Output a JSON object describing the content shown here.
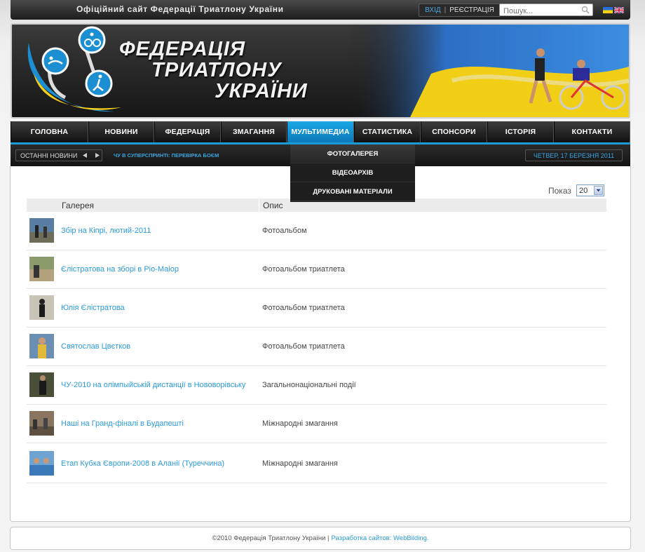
{
  "topbar": {
    "site_title": "Офіційний сайт Федерації Триатлону України",
    "login": "ВХІД",
    "separator": "|",
    "register": "РЕЄСТРАЦІЯ",
    "search_placeholder": "Пошук..."
  },
  "banner": {
    "title_line1": "ФЕДЕРАЦІЯ",
    "title_line2": "ТРИАТЛОНУ",
    "title_line3": "УКРАЇНИ"
  },
  "nav": {
    "items": [
      {
        "label": "ГОЛОВНА"
      },
      {
        "label": "НОВИНИ"
      },
      {
        "label": "ФЕДЕРАЦІЯ"
      },
      {
        "label": "ЗМАГАННЯ"
      },
      {
        "label": "МУЛЬТИМЕДИА"
      },
      {
        "label": "СТАТИСТИКА"
      },
      {
        "label": "СПОНСОРИ"
      },
      {
        "label": "ІСТОРІЯ"
      },
      {
        "label": "КОНТАКТИ"
      }
    ],
    "active_index": 4
  },
  "dropdown": {
    "items": [
      "ФОТОГАЛЕРЕЯ",
      "ВІДЕОАРХІВ",
      "ДРУКОВАНІ МАТЕРІАЛИ"
    ]
  },
  "subbar": {
    "latest_news": "ОСТАННІ НОВИНИ",
    "ticker": "ЧУ В СУПЕРСПРИНТІ: ПЕРЕВІРКА БОЄМ",
    "date": "ЧЕТВЕР, 17 БЕРЕЗНЯ 2011"
  },
  "gallery": {
    "show_label": "Показ",
    "show_value": "20",
    "col_gallery": "Галерея",
    "col_description": "Опис",
    "rows": [
      {
        "title": "Збір на Кіпрі, лютий-2011",
        "description": "Фотоальбом"
      },
      {
        "title": "Єлістратова на зборі в Ріо-Маіор",
        "description": "Фотоальбом триатлета"
      },
      {
        "title": "Юлія Єлістратова",
        "description": "Фотоальбом триатлета"
      },
      {
        "title": "Святослав Цвєтков",
        "description": "Фотоальбом триатлета"
      },
      {
        "title": "ЧУ-2010 на олімпыйській дистанції в Нововорівську",
        "description": "Загальнонаціональні події"
      },
      {
        "title": "Наші на Гранд-фіналі в Будапешті",
        "description": "Міжнародні змагання"
      },
      {
        "title": "Етап Кубка Європи-2008 в Аланії (Туреччина)",
        "description": "Міжнародні змагання"
      }
    ]
  },
  "footer": {
    "copyright": "©2010 Федерація Триатлону України |",
    "developer": "Разработка сайтов: WebBilding."
  },
  "colors": {
    "accent": "#1a9ad6",
    "link": "#2b9ad8",
    "header_bg": "#1c1c1c"
  }
}
